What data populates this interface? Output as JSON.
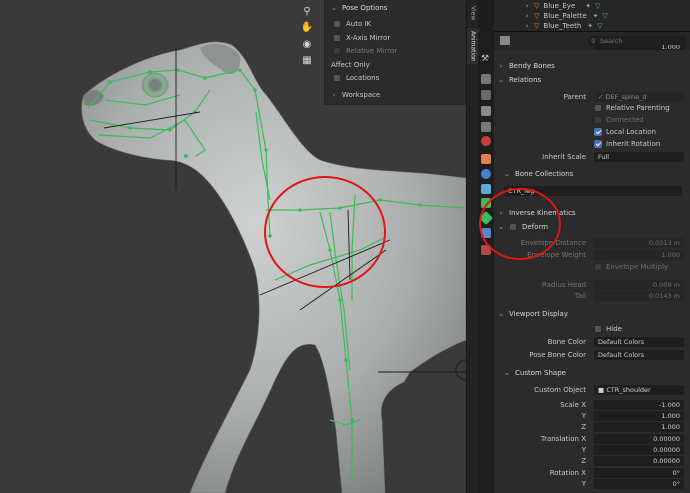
{
  "pose_options": {
    "header": "Pose Options",
    "auto_ik": "Auto IK",
    "x_axis_mirror": "X-Axis Mirror",
    "relative_mirror": "Relative Mirror",
    "affect_only": "Affect Only",
    "locations": "Locations",
    "workspace": "Workspace"
  },
  "side_tabs": {
    "view": "View",
    "animation": "Animation"
  },
  "outliner": {
    "items": [
      {
        "label": "Blue_Eye"
      },
      {
        "label": "Blue_Palette"
      },
      {
        "label": "Blue_Teeth"
      }
    ]
  },
  "properties": {
    "search_placeholder": "Search",
    "top_value": "1.000",
    "bendy_bones": "Bendy Bones",
    "relations": {
      "header": "Relations",
      "parent_label": "Parent",
      "parent_value": "DEF_spine_d",
      "relative_parenting": "Relative Parenting",
      "connected": "Connected",
      "local_location": "Local Location",
      "inherit_rotation": "Inherit Rotation",
      "inherit_scale_label": "Inherit Scale",
      "inherit_scale_value": "Full",
      "bone_collections": "Bone Collections",
      "collection_value": "CTR_leg"
    },
    "inverse_kinematics": "Inverse Kinematics",
    "deform": {
      "header": "Deform",
      "envelope_distance_label": "Envelope Distance",
      "envelope_distance": "0.0313 m",
      "envelope_weight_label": "Envelope Weight",
      "envelope_weight": "1.000",
      "envelope_multiply": "Envelope Multiply",
      "radius_head_label": "Radius Head",
      "radius_head": "0.009 m",
      "tail_label": "Tail",
      "tail": "0.0143 m"
    },
    "viewport_display": {
      "header": "Viewport Display",
      "hide": "Hide",
      "bone_color_label": "Bone Color",
      "bone_color": "Default Colors",
      "pose_bone_color_label": "Pose Bone Color",
      "pose_bone_color": "Default Colors"
    },
    "custom_shape": {
      "header": "Custom Shape",
      "custom_object_label": "Custom Object",
      "custom_object": "CTR_shoulder",
      "scale_x_label": "Scale X",
      "scale_x": "-1.000",
      "scale_y_label": "Y",
      "scale_y": "1.000",
      "scale_z_label": "Z",
      "scale_z": "1.000",
      "translation_x_label": "Translation X",
      "translation_x": "0.00000",
      "translation_y_label": "Y",
      "translation_y": "0.00000",
      "translation_z_label": "Z",
      "translation_z": "0.00000",
      "rotation_x_label": "Rotation X",
      "rotation_x": "0°",
      "rotation_y_label": "Y",
      "rotation_y": "0°"
    }
  },
  "colors": {
    "accent": "#4772b3",
    "bone_green": "#3dbb5c",
    "annotation_red": "#e01515"
  }
}
